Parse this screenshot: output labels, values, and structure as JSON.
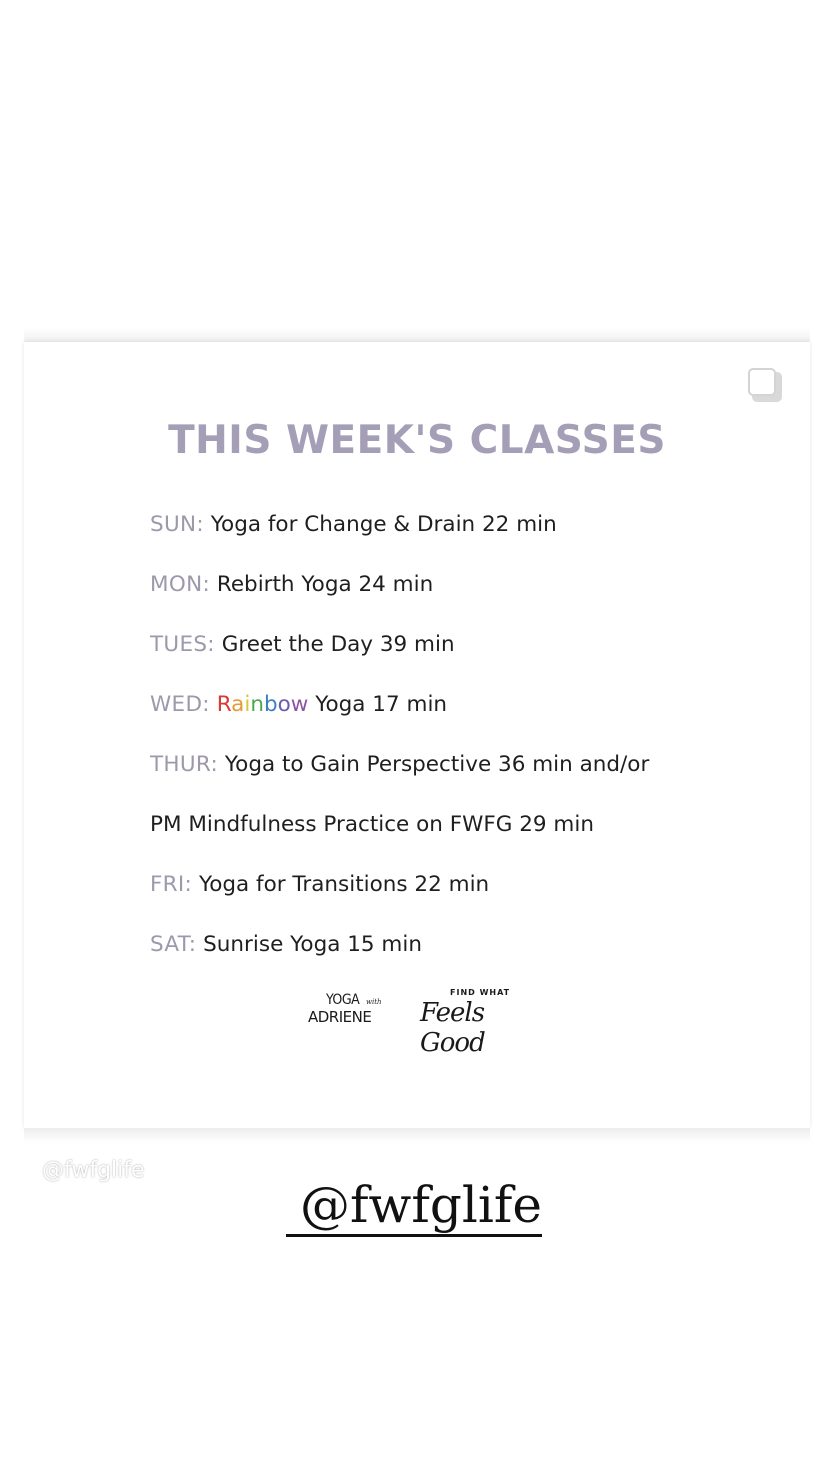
{
  "colors": {
    "title": "#a49eb7",
    "day_label": "#9d98ab",
    "text": "#1f1f1f",
    "rainbow": [
      "#d83a34",
      "#e49a31",
      "#d8c82b",
      "#4aa84f",
      "#3c7fc4",
      "#6b5bb0",
      "#8e53a3"
    ]
  },
  "post": {
    "icon": "carousel-multiple-icon",
    "title": "THIS WEEK'S CLASSES",
    "schedule": [
      {
        "day": "SUN:",
        "text": "Yoga for Change & Drain 22 min"
      },
      {
        "day": "MON:",
        "text": "Rebirth Yoga 24 min"
      },
      {
        "day": "TUES:",
        "text": "Greet the Day 39 min"
      },
      {
        "day": "WED:",
        "rainbow_word": "Rainbow",
        "text": "Yoga 17 min"
      },
      {
        "day": "THUR:",
        "text": "Yoga to Gain Perspective 36 min and/or"
      },
      {
        "day": "",
        "text": "PM Mindfulness Practice on FWFG 29 min"
      },
      {
        "day": "FRI:",
        "text": "Yoga for Transitions 22 min"
      },
      {
        "day": "SAT:",
        "text": "Sunrise Yoga 15 min"
      }
    ],
    "logo_yoga": {
      "line1": "YOGA",
      "with": "with",
      "line2": "ADRIENE"
    },
    "logo_fwfg": {
      "small": "FIND WHAT",
      "script": "Feels Good"
    }
  },
  "watermark": "@fwfglife",
  "story_handle": "@fwfglife"
}
